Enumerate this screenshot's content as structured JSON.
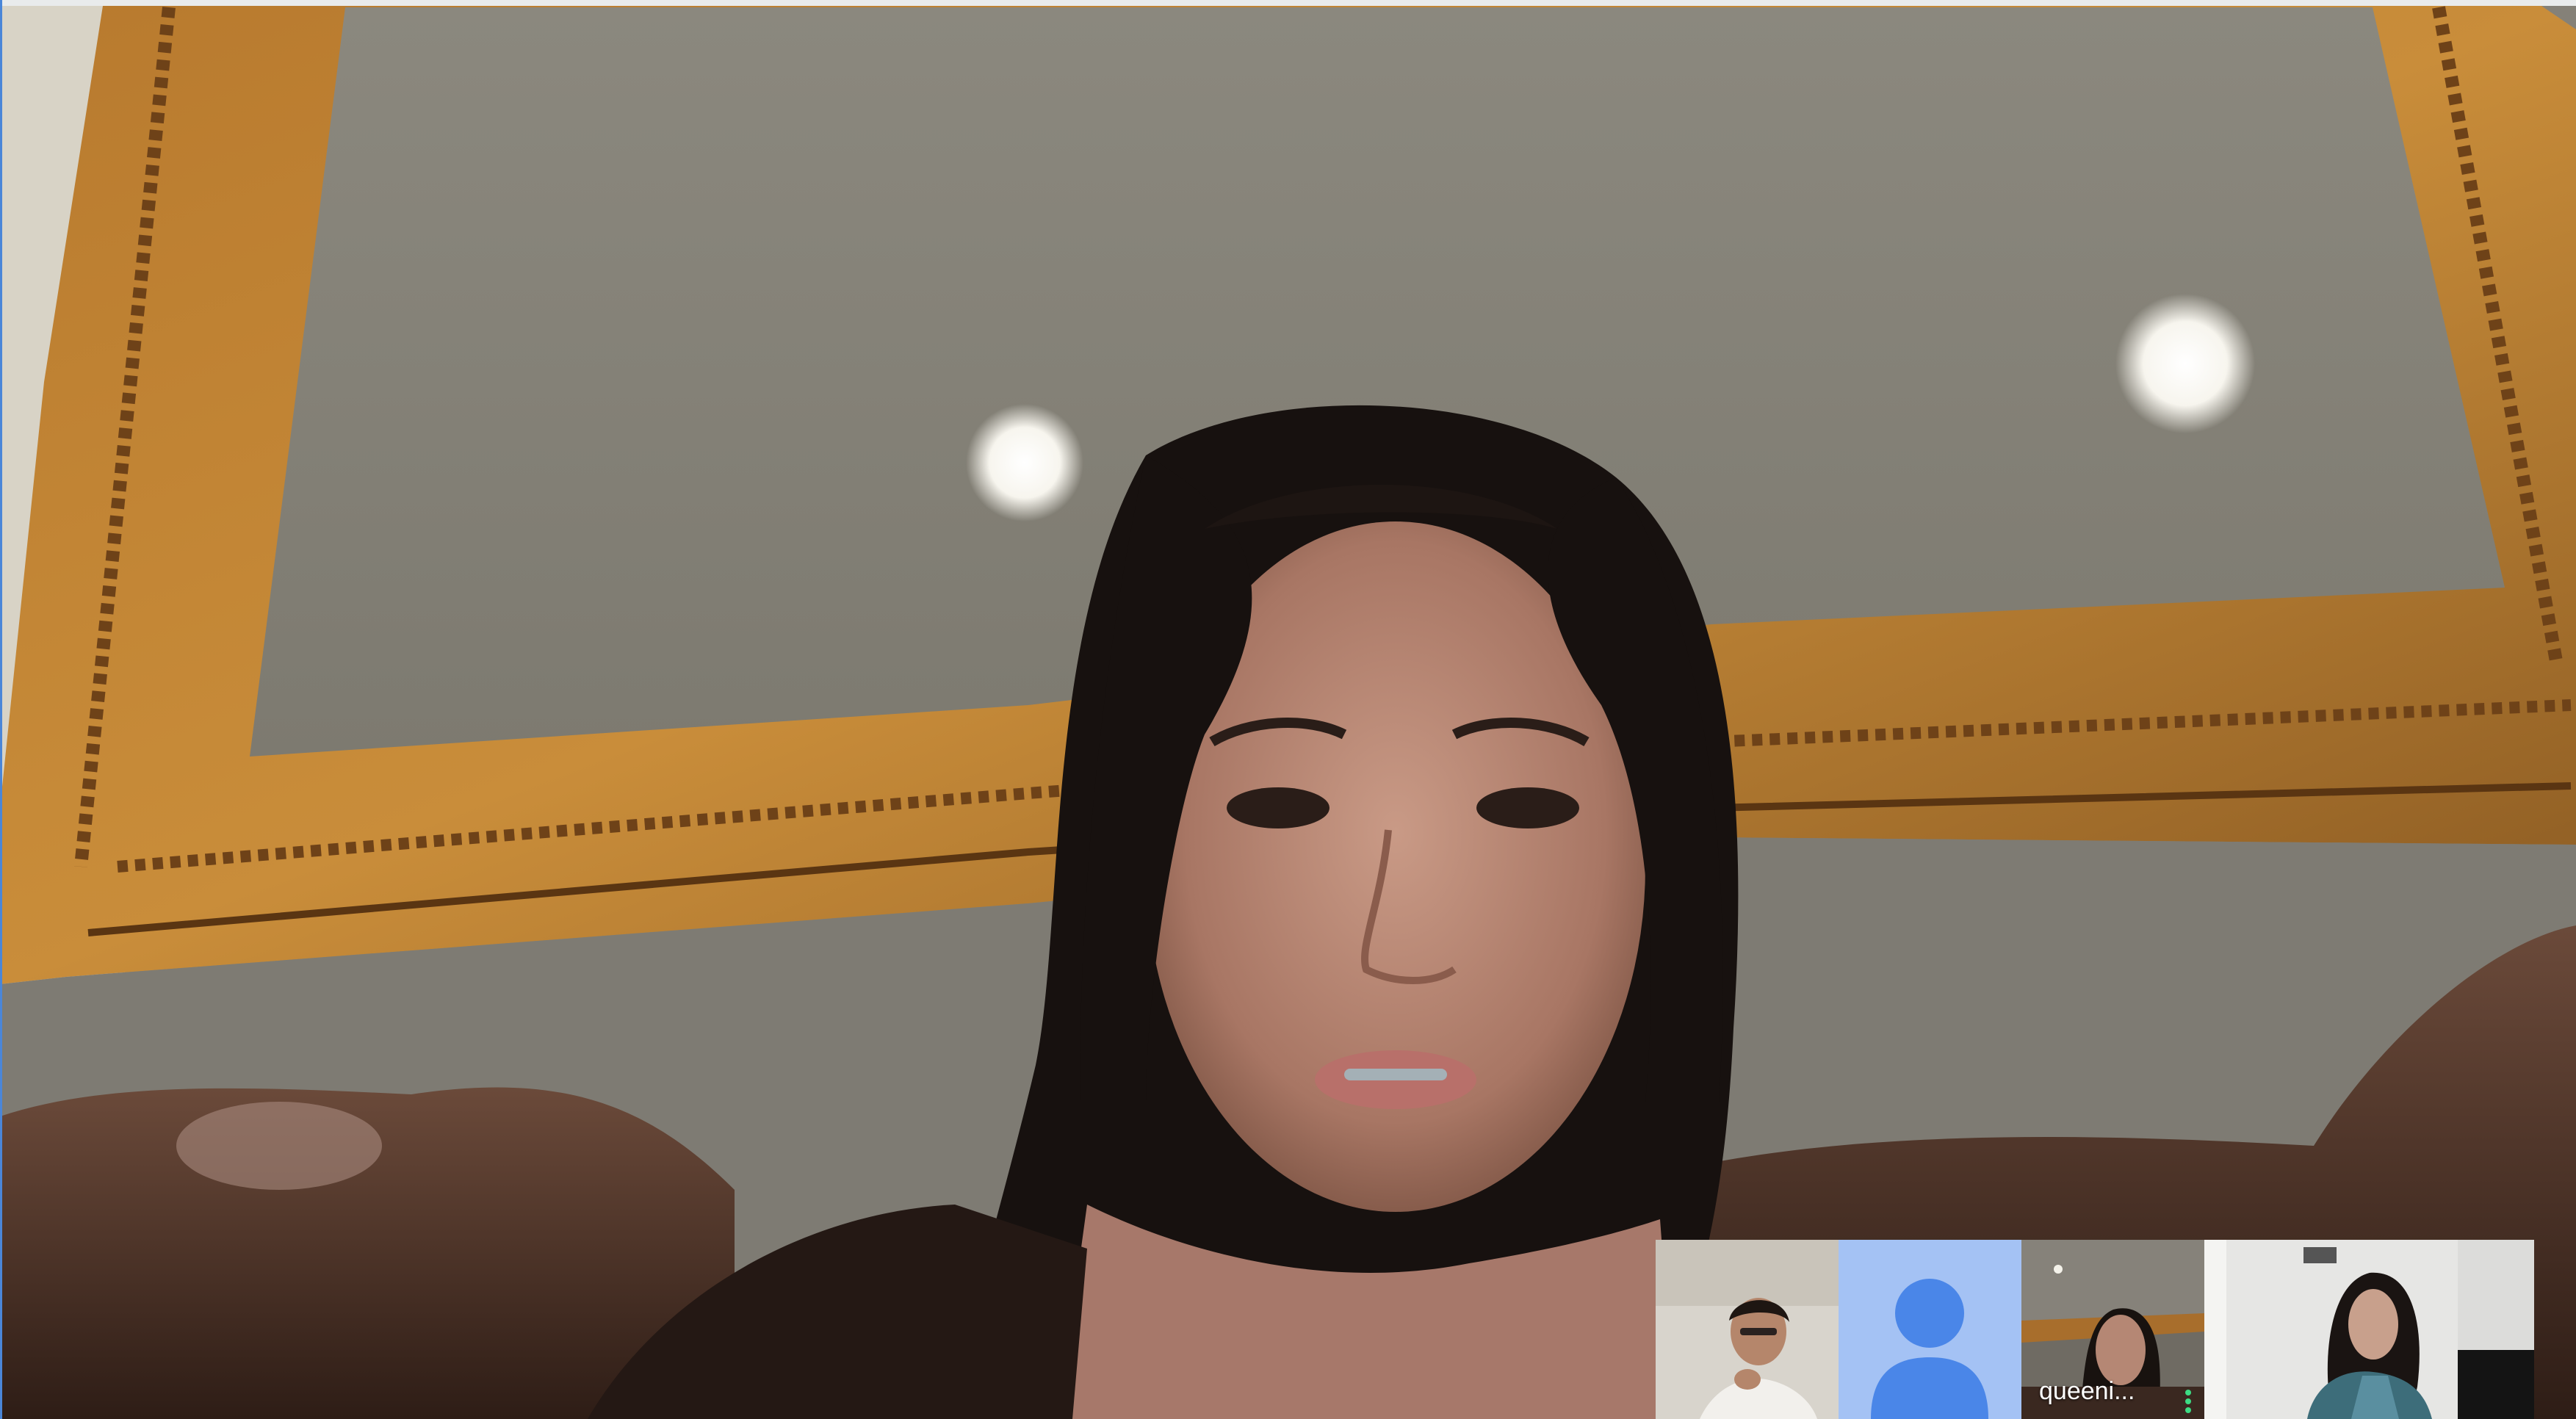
{
  "call": {
    "main_speaker_label": "",
    "participants": [
      {
        "id": "p1",
        "name": "",
        "has_video": true
      },
      {
        "id": "p2",
        "name": "",
        "has_video": false,
        "avatar": "person-icon"
      },
      {
        "id": "p3",
        "name": "queeni...",
        "has_video": true,
        "speaking": true
      },
      {
        "id": "p4",
        "name": "",
        "has_video": true
      }
    ]
  },
  "colors": {
    "avatar_tile_bg": "#a4c2f4",
    "avatar_icon": "#4a86e8",
    "speaking_indicator": "#3ddc84"
  }
}
